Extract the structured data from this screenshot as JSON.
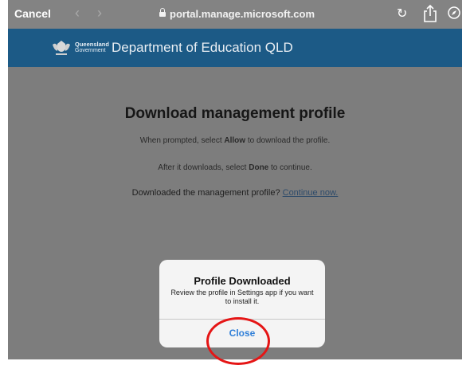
{
  "browser": {
    "cancel_label": "Cancel",
    "back_icon": "chevron-left-icon",
    "forward_icon": "chevron-right-icon",
    "url": "portal.manage.microsoft.com",
    "reload_icon": "reload-icon",
    "share_icon": "share-icon",
    "compass_icon": "compass-icon"
  },
  "header": {
    "logo_line1": "Queensland",
    "logo_line2": "Government",
    "title": "Department of Education QLD",
    "color": "#1c5a86"
  },
  "page": {
    "title": "Download management profile",
    "line1_pre": "When prompted, select ",
    "line1_bold": "Allow",
    "line1_post": " to download the profile.",
    "line2_pre": "After it downloads, select ",
    "line2_bold": "Done",
    "line2_post": " to continue.",
    "line3_text": "Downloaded the management profile? ",
    "line3_link": "Continue now."
  },
  "alert": {
    "title": "Profile Downloaded",
    "message": "Review the profile in Settings app if you want to install it.",
    "close_label": "Close",
    "accent": "#2f7fd8"
  },
  "annotation": {
    "color": "#e51515"
  }
}
